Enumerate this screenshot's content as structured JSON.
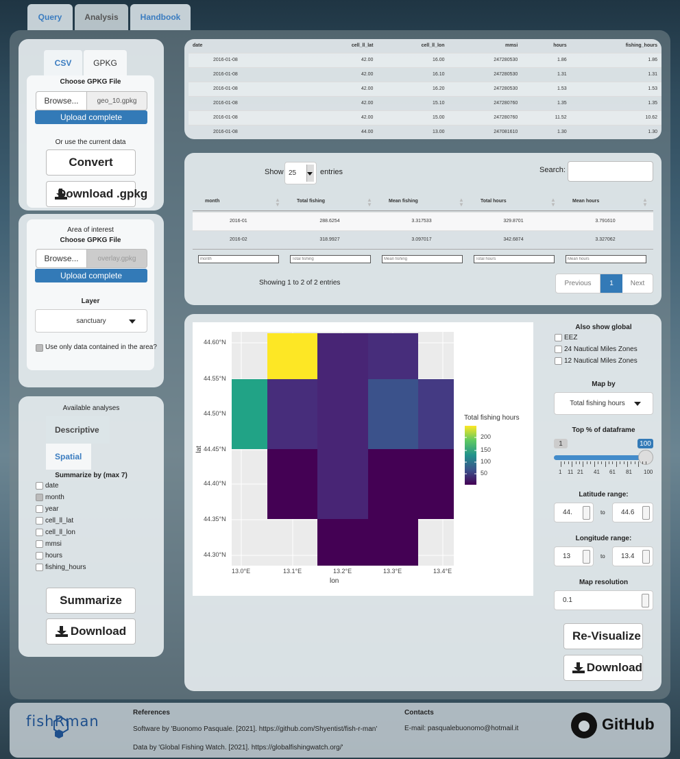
{
  "tabs": [
    "Query",
    "Analysis",
    "Handbook"
  ],
  "left1": {
    "subtabs": [
      "CSV",
      "GPKG"
    ],
    "choose_file": "Choose GPKG File",
    "browse": "Browse...",
    "file": "geo_10.gpkg",
    "upload": "Upload complete",
    "or_use": "Or use the current data",
    "convert": "Convert",
    "download_gpkg": "Download .gpkg"
  },
  "left2": {
    "area": "Area of interest",
    "choose_file": "Choose GPKG File",
    "browse": "Browse...",
    "file": "overlay.gpkg",
    "upload": "Upload complete",
    "layer_label": "Layer",
    "layer_value": "sanctuary",
    "only_area": "Use only data contained in the area?"
  },
  "left3": {
    "available": "Available analyses",
    "descriptive": "Descriptive",
    "spatial": "Spatial",
    "summarize_by": "Summarize by (max 7)",
    "fields": [
      "date",
      "month",
      "year",
      "cell_ll_lat",
      "cell_ll_lon",
      "mmsi",
      "hours",
      "fishing_hours"
    ],
    "checked": [
      false,
      true,
      false,
      false,
      false,
      false,
      false,
      false
    ],
    "summarize": "Summarize",
    "download": "Download"
  },
  "table1": {
    "headers": [
      "date",
      "cell_ll_lat",
      "cell_ll_lon",
      "mmsi",
      "hours",
      "fishing_hours"
    ],
    "rows": [
      [
        "2016-01-08",
        "42.00",
        "16.00",
        "247280530",
        "1.86",
        "1.86"
      ],
      [
        "2016-01-08",
        "42.00",
        "16.10",
        "247280530",
        "1.31",
        "1.31"
      ],
      [
        "2016-01-08",
        "42.00",
        "16.20",
        "247280530",
        "1.53",
        "1.53"
      ],
      [
        "2016-01-08",
        "42.00",
        "15.10",
        "247280760",
        "1.35",
        "1.35"
      ],
      [
        "2016-01-08",
        "42.00",
        "15.00",
        "247280760",
        "11.52",
        "10.62"
      ],
      [
        "2016-01-08",
        "44.00",
        "13.00",
        "247081610",
        "1.30",
        "1.30"
      ]
    ]
  },
  "table2": {
    "show": "Show",
    "entries_value": "25",
    "entries": "entries",
    "search": "Search:",
    "headers": [
      "month",
      "Total fishing",
      "Mean fishing",
      "Total hours",
      "Mean hours"
    ],
    "rows": [
      [
        "2016-01",
        "288.6254",
        "3.317533",
        "329.8701",
        "3.791610"
      ],
      [
        "2016-02",
        "318.9927",
        "3.097017",
        "342.6874",
        "3.327062"
      ]
    ],
    "filters": [
      "month",
      "Total fishing",
      "Mean fishing",
      "Total hours",
      "Mean hours"
    ],
    "info": "Showing 1 to 2 of 2 entries",
    "previous": "Previous",
    "page": "1",
    "next": "Next"
  },
  "map": {
    "ylabels": [
      "44.60°N",
      "44.55°N",
      "44.50°N",
      "44.45°N",
      "44.40°N",
      "44.35°N",
      "44.30°N"
    ],
    "xlabels": [
      "13.0°E",
      "13.1°E",
      "13.2°E",
      "13.3°E",
      "13.4°E"
    ],
    "xlab": "lon",
    "ylab": "lat",
    "legend_title": "Total fishing hours",
    "legend_ticks": [
      "200",
      "150",
      "100",
      "50"
    ],
    "colors": {
      "yellow": "#fde725",
      "teal": "#21a386",
      "purple_dark": "#440154",
      "purple": "#482575",
      "purple_mid": "#472d7b",
      "blue_purple": "#3b528b",
      "indigo": "#443a83",
      "navy": "#46337e"
    }
  },
  "controls": {
    "also_show": "Also show global",
    "global": [
      "EEZ",
      "24 Nautical Miles Zones",
      "12 Nautical Miles Zones"
    ],
    "map_by": "Map by",
    "map_by_value": "Total fishing hours",
    "top_pct": "Top % of dataframe",
    "slider_min": "1",
    "slider_max": "100",
    "slider_ticks": [
      "1",
      "11",
      "21",
      "41",
      "61",
      "81",
      "100"
    ],
    "lat_range": "Latitude range:",
    "lat_from": "44.",
    "lat_to": "44.6",
    "to": "to",
    "lon_range": "Longitude range:",
    "lon_from": "13",
    "lon_to": "13.4",
    "resolution": "Map resolution",
    "res_value": "0.1",
    "revisualize": "Re-Visualize",
    "download": "Download"
  },
  "footer": {
    "logo": "fishRman",
    "references": "References",
    "ref1": "Software by 'Buonomo Pasquale. [2021]. https://github.com/Shyentist/fish-r-man'",
    "ref2": "Data by 'Global Fishing Watch. [2021]. https://globalfishingwatch.org/'",
    "contacts": "Contacts",
    "email": "E-mail: pasqualebuonomo@hotmail.it",
    "github": "GitHub"
  }
}
